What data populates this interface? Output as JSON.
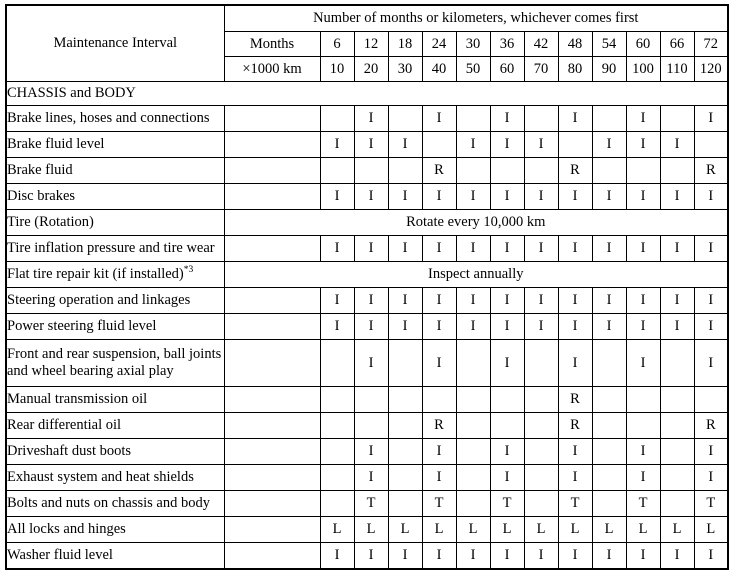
{
  "table": {
    "corner_label": "Maintenance Interval",
    "group_header": "Number of months or kilometers, whichever comes first",
    "row_label_months": "Months",
    "row_label_km": "×1000 km",
    "months": [
      "6",
      "12",
      "18",
      "24",
      "30",
      "36",
      "42",
      "48",
      "54",
      "60",
      "66",
      "72"
    ],
    "kilometers": [
      "10",
      "20",
      "30",
      "40",
      "50",
      "60",
      "70",
      "80",
      "90",
      "100",
      "110",
      "120"
    ],
    "section_title": "CHASSIS and BODY",
    "header_bg": "#e2e2e2",
    "rows": [
      {
        "label": "Brake lines, hoses and connections",
        "type": "marks",
        "marks": [
          "",
          "I",
          "",
          "I",
          "",
          "I",
          "",
          "I",
          "",
          "I",
          "",
          "I"
        ]
      },
      {
        "label": "Brake fluid level",
        "type": "marks",
        "marks": [
          "I",
          "I",
          "I",
          "",
          "I",
          "I",
          "I",
          "",
          "I",
          "I",
          "I",
          ""
        ]
      },
      {
        "label": "Brake fluid",
        "type": "marks",
        "marks": [
          "",
          "",
          "",
          "R",
          "",
          "",
          "",
          "R",
          "",
          "",
          "",
          "R"
        ]
      },
      {
        "label": "Disc brakes",
        "type": "marks",
        "marks": [
          "I",
          "I",
          "I",
          "I",
          "I",
          "I",
          "I",
          "I",
          "I",
          "I",
          "I",
          "I"
        ]
      },
      {
        "label": "Tire (Rotation)",
        "type": "note",
        "note": "Rotate every 10,000 km"
      },
      {
        "label": "Tire inflation pressure and tire wear",
        "type": "marks",
        "marks": [
          "I",
          "I",
          "I",
          "I",
          "I",
          "I",
          "I",
          "I",
          "I",
          "I",
          "I",
          "I"
        ]
      },
      {
        "label": "Flat tire repair kit (if installed)",
        "label_sup": "*3",
        "type": "note",
        "note": "Inspect annually"
      },
      {
        "label": "Steering operation and linkages",
        "type": "marks",
        "marks": [
          "I",
          "I",
          "I",
          "I",
          "I",
          "I",
          "I",
          "I",
          "I",
          "I",
          "I",
          "I"
        ]
      },
      {
        "label": "Power steering fluid level",
        "type": "marks",
        "marks": [
          "I",
          "I",
          "I",
          "I",
          "I",
          "I",
          "I",
          "I",
          "I",
          "I",
          "I",
          "I"
        ]
      },
      {
        "label": "Front and rear suspension, ball joints and wheel bearing axial play",
        "type": "marks",
        "tall": true,
        "marks": [
          "",
          "I",
          "",
          "I",
          "",
          "I",
          "",
          "I",
          "",
          "I",
          "",
          "I"
        ]
      },
      {
        "label": "Manual transmission oil",
        "type": "marks",
        "marks": [
          "",
          "",
          "",
          "",
          "",
          "",
          "",
          "R",
          "",
          "",
          "",
          ""
        ]
      },
      {
        "label": "Rear differential oil",
        "type": "marks",
        "marks": [
          "",
          "",
          "",
          "R",
          "",
          "",
          "",
          "R",
          "",
          "",
          "",
          "R"
        ]
      },
      {
        "label": "Driveshaft dust boots",
        "type": "marks",
        "marks": [
          "",
          "I",
          "",
          "I",
          "",
          "I",
          "",
          "I",
          "",
          "I",
          "",
          "I"
        ]
      },
      {
        "label": "Exhaust system and heat shields",
        "type": "marks",
        "marks": [
          "",
          "I",
          "",
          "I",
          "",
          "I",
          "",
          "I",
          "",
          "I",
          "",
          "I"
        ]
      },
      {
        "label": "Bolts and nuts on chassis and body",
        "type": "marks",
        "marks": [
          "",
          "T",
          "",
          "T",
          "",
          "T",
          "",
          "T",
          "",
          "T",
          "",
          "T"
        ]
      },
      {
        "label": "All locks and hinges",
        "type": "marks",
        "marks": [
          "L",
          "L",
          "L",
          "L",
          "L",
          "L",
          "L",
          "L",
          "L",
          "L",
          "L",
          "L"
        ]
      },
      {
        "label": "Washer fluid level",
        "type": "marks",
        "marks": [
          "I",
          "I",
          "I",
          "I",
          "I",
          "I",
          "I",
          "I",
          "I",
          "I",
          "I",
          "I"
        ]
      }
    ]
  }
}
